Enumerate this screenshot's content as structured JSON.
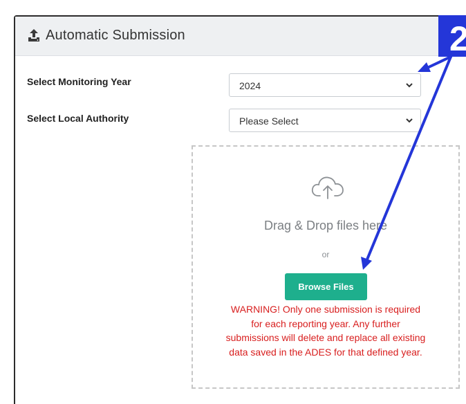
{
  "header": {
    "title": "Automatic Submission",
    "icon": "upload-icon"
  },
  "form": {
    "monitoring_year": {
      "label": "Select Monitoring Year",
      "value": "2024"
    },
    "local_authority": {
      "label": "Select Local Authority",
      "value": "Please Select"
    }
  },
  "dropzone": {
    "title": "Drag & Drop files here",
    "or": "or",
    "browse_label": "Browse Files",
    "warning_lines": [
      "WARNING! Only one submission is required",
      "for each reporting year. Any further",
      "submissions will delete and replace all existing",
      "data saved in the ADES for that defined year."
    ]
  },
  "annotation": {
    "step_number": "2"
  },
  "colors": {
    "accent": "#1eaf8d",
    "warning": "#d81e1e",
    "annotation": "#2436d8"
  }
}
